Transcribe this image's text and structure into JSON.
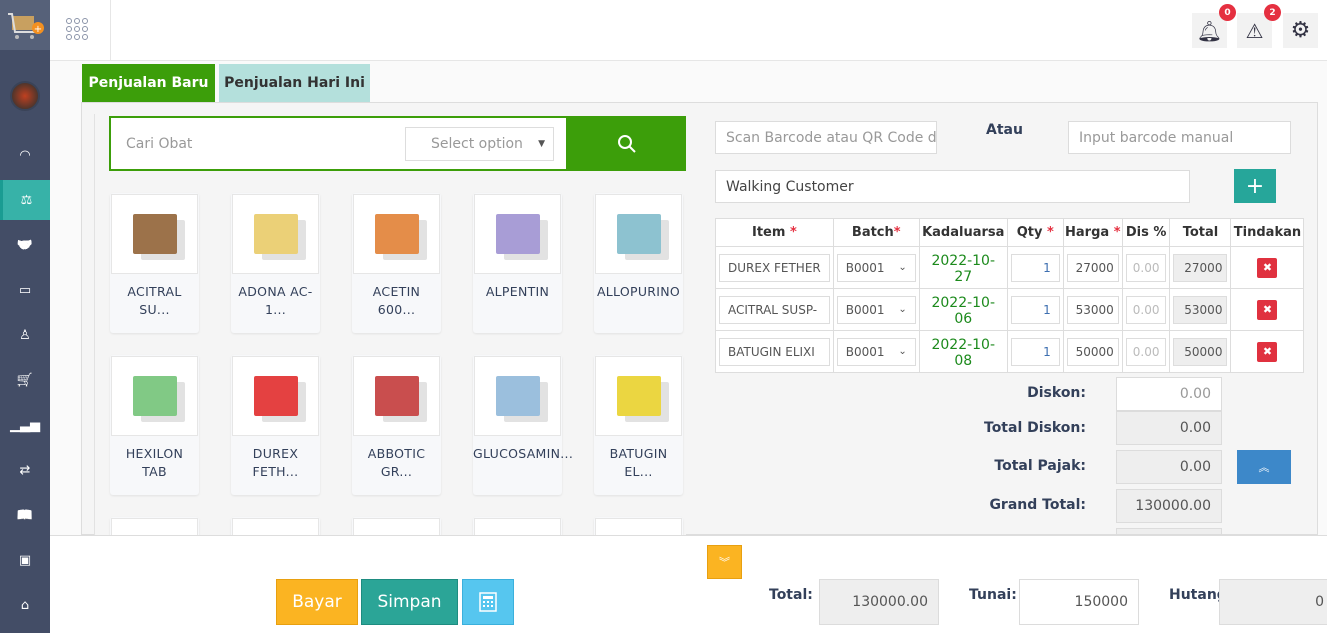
{
  "sidebar": {
    "items": [
      {
        "icon": "dashboard-icon",
        "glyph": "◠"
      },
      {
        "icon": "scale-icon",
        "glyph": "⚖",
        "active": true
      },
      {
        "icon": "handshake-icon",
        "glyph": "🤝"
      },
      {
        "icon": "briefcase-icon",
        "glyph": "▭"
      },
      {
        "icon": "user-icon",
        "glyph": "♙"
      },
      {
        "icon": "cart-icon",
        "glyph": "🛒"
      },
      {
        "icon": "bar-chart-icon",
        "glyph": "▁▃▅"
      },
      {
        "icon": "refresh-icon",
        "glyph": "⇄"
      },
      {
        "icon": "book-icon",
        "glyph": "📖"
      },
      {
        "icon": "money-icon",
        "glyph": "▣"
      },
      {
        "icon": "toolbox-icon",
        "glyph": "⌂"
      }
    ]
  },
  "header": {
    "notifications_count": "0",
    "alerts_count": "2"
  },
  "tabs": [
    {
      "label": "Penjualan Baru",
      "active": true
    },
    {
      "label": "Penjualan Hari Ini"
    }
  ],
  "search": {
    "placeholder": "Cari Obat",
    "select_placeholder": "Select option"
  },
  "products": [
    {
      "name": "ACITRAL\nSU...",
      "color": "#8b5a2b"
    },
    {
      "name": "ADONA AC-\n1...",
      "color": "#e8c860"
    },
    {
      "name": "ACETIN\n600...",
      "color": "#e07a2a"
    },
    {
      "name": "ALPENTIN",
      "color": "#9a8cd0"
    },
    {
      "name": "ALLOPURINO",
      "color": "#7ab8c8"
    },
    {
      "name": "HEXILON\nTAB",
      "color": "#6cc070"
    },
    {
      "name": "DUREX\nFETH...",
      "color": "#e02020"
    },
    {
      "name": "ABBOTIC\nGR...",
      "color": "#c03030"
    },
    {
      "name": "GLUCOSAMIN...",
      "color": "#8ab4d8"
    },
    {
      "name": "BATUGIN\nEL...",
      "color": "#e8d020"
    },
    {
      "name": "",
      "color": "#f0a080"
    },
    {
      "name": "",
      "color": "#e0c030"
    },
    {
      "name": "",
      "color": "#e04090"
    },
    {
      "name": "",
      "color": "#304080"
    },
    {
      "name": "",
      "color": "#dddddd"
    }
  ],
  "barcode": {
    "scan_placeholder": "Scan Barcode atau QR Code di",
    "or_label": "Atau",
    "manual_placeholder": "Input barcode manual"
  },
  "customer": {
    "value": "Walking Customer",
    "add_label": "+"
  },
  "cart": {
    "headers": [
      "Item",
      "Batch",
      "Kadaluarsa",
      "Qty",
      "Harga",
      "Dis %",
      "Total",
      "Tindakan"
    ],
    "rows": [
      {
        "item": "DUREX FETHER",
        "batch": "B0001",
        "expiry": "2022-10-27",
        "qty": "1",
        "price": "27000",
        "disc": "0.00",
        "total": "27000"
      },
      {
        "item": "ACITRAL SUSP-",
        "batch": "B0001",
        "expiry": "2022-10-06",
        "qty": "1",
        "price": "53000",
        "disc": "0.00",
        "total": "53000"
      },
      {
        "item": "BATUGIN ELIXI",
        "batch": "B0001",
        "expiry": "2022-10-08",
        "qty": "1",
        "price": "50000",
        "disc": "0.00",
        "total": "50000"
      }
    ]
  },
  "summary": {
    "discount_label": "Diskon:",
    "discount": "0.00",
    "total_discount_label": "Total Diskon:",
    "total_discount": "0.00",
    "total_tax_label": "Total Pajak:",
    "total_tax": "0.00",
    "grand_total_label": "Grand Total:",
    "grand_total": "130000.00"
  },
  "footer": {
    "pay_label": "Bayar",
    "save_label": "Simpan",
    "total_label": "Total:",
    "total": "130000.00",
    "cash_label": "Tunai:",
    "cash": "150000",
    "debt_label": "Hutang",
    "debt": "0"
  },
  "colors": {
    "sidebar": "#434d66",
    "active": "#37b2a8",
    "green": "#3c9e0a",
    "teal": "#26a69a",
    "blue": "#3d88c9",
    "yellow": "#fbb422",
    "danger": "#e0313f"
  }
}
